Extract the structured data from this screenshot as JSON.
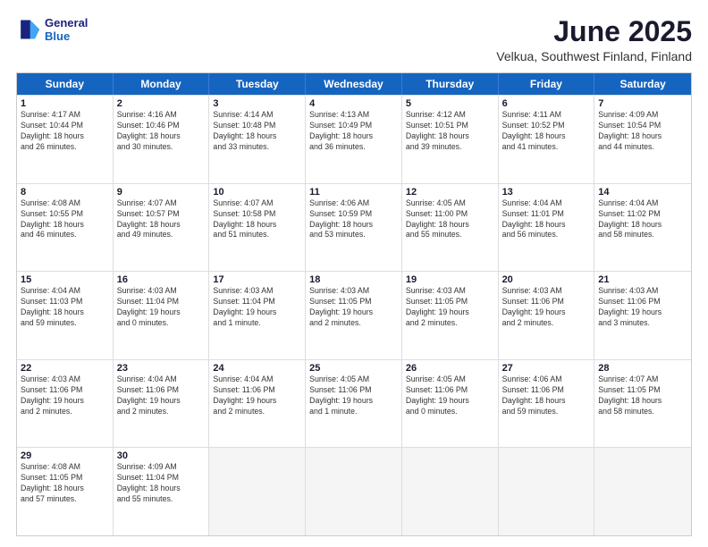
{
  "logo": {
    "line1": "General",
    "line2": "Blue"
  },
  "title": "June 2025",
  "subtitle": "Velkua, Southwest Finland, Finland",
  "header_days": [
    "Sunday",
    "Monday",
    "Tuesday",
    "Wednesday",
    "Thursday",
    "Friday",
    "Saturday"
  ],
  "weeks": [
    [
      {
        "day": "1",
        "text": "Sunrise: 4:17 AM\nSunset: 10:44 PM\nDaylight: 18 hours\nand 26 minutes."
      },
      {
        "day": "2",
        "text": "Sunrise: 4:16 AM\nSunset: 10:46 PM\nDaylight: 18 hours\nand 30 minutes."
      },
      {
        "day": "3",
        "text": "Sunrise: 4:14 AM\nSunset: 10:48 PM\nDaylight: 18 hours\nand 33 minutes."
      },
      {
        "day": "4",
        "text": "Sunrise: 4:13 AM\nSunset: 10:49 PM\nDaylight: 18 hours\nand 36 minutes."
      },
      {
        "day": "5",
        "text": "Sunrise: 4:12 AM\nSunset: 10:51 PM\nDaylight: 18 hours\nand 39 minutes."
      },
      {
        "day": "6",
        "text": "Sunrise: 4:11 AM\nSunset: 10:52 PM\nDaylight: 18 hours\nand 41 minutes."
      },
      {
        "day": "7",
        "text": "Sunrise: 4:09 AM\nSunset: 10:54 PM\nDaylight: 18 hours\nand 44 minutes."
      }
    ],
    [
      {
        "day": "8",
        "text": "Sunrise: 4:08 AM\nSunset: 10:55 PM\nDaylight: 18 hours\nand 46 minutes."
      },
      {
        "day": "9",
        "text": "Sunrise: 4:07 AM\nSunset: 10:57 PM\nDaylight: 18 hours\nand 49 minutes."
      },
      {
        "day": "10",
        "text": "Sunrise: 4:07 AM\nSunset: 10:58 PM\nDaylight: 18 hours\nand 51 minutes."
      },
      {
        "day": "11",
        "text": "Sunrise: 4:06 AM\nSunset: 10:59 PM\nDaylight: 18 hours\nand 53 minutes."
      },
      {
        "day": "12",
        "text": "Sunrise: 4:05 AM\nSunset: 11:00 PM\nDaylight: 18 hours\nand 55 minutes."
      },
      {
        "day": "13",
        "text": "Sunrise: 4:04 AM\nSunset: 11:01 PM\nDaylight: 18 hours\nand 56 minutes."
      },
      {
        "day": "14",
        "text": "Sunrise: 4:04 AM\nSunset: 11:02 PM\nDaylight: 18 hours\nand 58 minutes."
      }
    ],
    [
      {
        "day": "15",
        "text": "Sunrise: 4:04 AM\nSunset: 11:03 PM\nDaylight: 18 hours\nand 59 minutes."
      },
      {
        "day": "16",
        "text": "Sunrise: 4:03 AM\nSunset: 11:04 PM\nDaylight: 19 hours\nand 0 minutes."
      },
      {
        "day": "17",
        "text": "Sunrise: 4:03 AM\nSunset: 11:04 PM\nDaylight: 19 hours\nand 1 minute."
      },
      {
        "day": "18",
        "text": "Sunrise: 4:03 AM\nSunset: 11:05 PM\nDaylight: 19 hours\nand 2 minutes."
      },
      {
        "day": "19",
        "text": "Sunrise: 4:03 AM\nSunset: 11:05 PM\nDaylight: 19 hours\nand 2 minutes."
      },
      {
        "day": "20",
        "text": "Sunrise: 4:03 AM\nSunset: 11:06 PM\nDaylight: 19 hours\nand 2 minutes."
      },
      {
        "day": "21",
        "text": "Sunrise: 4:03 AM\nSunset: 11:06 PM\nDaylight: 19 hours\nand 3 minutes."
      }
    ],
    [
      {
        "day": "22",
        "text": "Sunrise: 4:03 AM\nSunset: 11:06 PM\nDaylight: 19 hours\nand 2 minutes."
      },
      {
        "day": "23",
        "text": "Sunrise: 4:04 AM\nSunset: 11:06 PM\nDaylight: 19 hours\nand 2 minutes."
      },
      {
        "day": "24",
        "text": "Sunrise: 4:04 AM\nSunset: 11:06 PM\nDaylight: 19 hours\nand 2 minutes."
      },
      {
        "day": "25",
        "text": "Sunrise: 4:05 AM\nSunset: 11:06 PM\nDaylight: 19 hours\nand 1 minute."
      },
      {
        "day": "26",
        "text": "Sunrise: 4:05 AM\nSunset: 11:06 PM\nDaylight: 19 hours\nand 0 minutes."
      },
      {
        "day": "27",
        "text": "Sunrise: 4:06 AM\nSunset: 11:06 PM\nDaylight: 18 hours\nand 59 minutes."
      },
      {
        "day": "28",
        "text": "Sunrise: 4:07 AM\nSunset: 11:05 PM\nDaylight: 18 hours\nand 58 minutes."
      }
    ],
    [
      {
        "day": "29",
        "text": "Sunrise: 4:08 AM\nSunset: 11:05 PM\nDaylight: 18 hours\nand 57 minutes."
      },
      {
        "day": "30",
        "text": "Sunrise: 4:09 AM\nSunset: 11:04 PM\nDaylight: 18 hours\nand 55 minutes."
      },
      {
        "day": "",
        "text": ""
      },
      {
        "day": "",
        "text": ""
      },
      {
        "day": "",
        "text": ""
      },
      {
        "day": "",
        "text": ""
      },
      {
        "day": "",
        "text": ""
      }
    ]
  ]
}
